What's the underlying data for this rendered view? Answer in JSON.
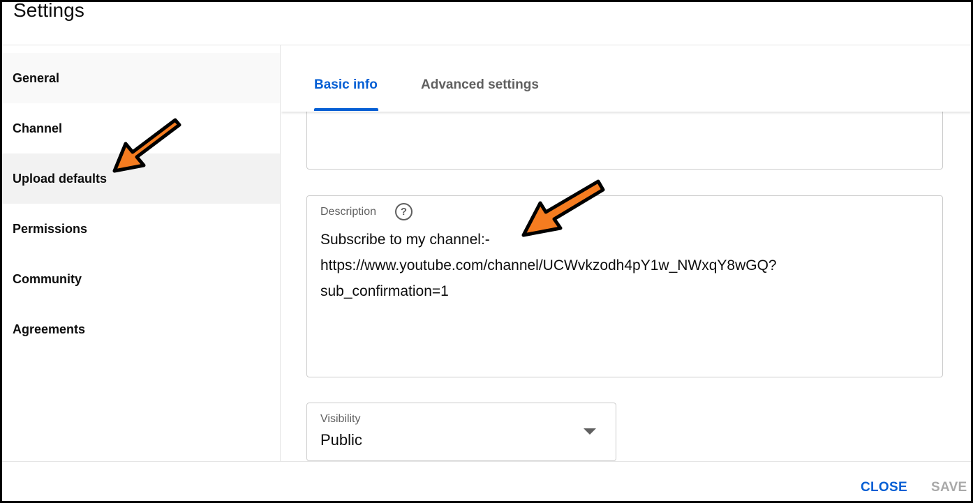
{
  "dialog": {
    "title": "Settings"
  },
  "sidebar": {
    "items": [
      {
        "label": "General"
      },
      {
        "label": "Channel"
      },
      {
        "label": "Upload defaults"
      },
      {
        "label": "Permissions"
      },
      {
        "label": "Community"
      },
      {
        "label": "Agreements"
      }
    ],
    "selected": "Upload defaults"
  },
  "tabs": [
    {
      "label": "Basic info",
      "active": true
    },
    {
      "label": "Advanced settings",
      "active": false
    }
  ],
  "form": {
    "description": {
      "label": "Description",
      "help_icon": "help-circle-icon",
      "value": "Subscribe to my channel:-\nhttps://www.youtube.com/channel/UCWvkzodh4pY1w_NWxqY8wGQ?\nsub_confirmation=1"
    },
    "visibility": {
      "label": "Visibility",
      "value": "Public",
      "icon": "caret-down-icon"
    }
  },
  "footer": {
    "close_label": "CLOSE",
    "save_label": "SAVE"
  },
  "colors": {
    "accent": "#065fd4",
    "annotation_arrow": "#f57c20",
    "disabled": "#a9a9a9"
  }
}
